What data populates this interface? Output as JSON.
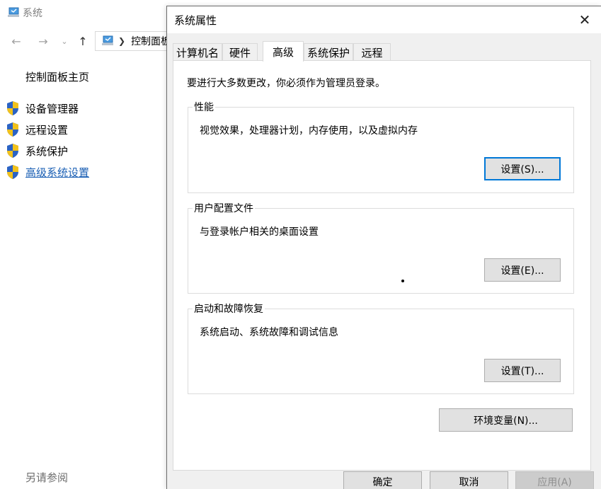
{
  "system_window": {
    "title": "系统",
    "address": "控制面板",
    "home_link": "控制面板主页",
    "links": [
      {
        "label": "设备管理器"
      },
      {
        "label": "远程设置"
      },
      {
        "label": "系统保护"
      },
      {
        "label": "高级系统设置"
      }
    ],
    "see_also": "另请参阅"
  },
  "dialog": {
    "title": "系统属性",
    "tabs": [
      {
        "label": "计算机名"
      },
      {
        "label": "硬件"
      },
      {
        "label": "高级"
      },
      {
        "label": "系统保护"
      },
      {
        "label": "远程"
      }
    ],
    "active_tab": "高级",
    "note": "要进行大多数更改，你必须作为管理员登录。",
    "groups": [
      {
        "title": "性能",
        "desc": "视觉效果，处理器计划，内存使用，以及虚拟内存",
        "button": "设置(S)..."
      },
      {
        "title": "用户配置文件",
        "desc": "与登录帐户相关的桌面设置",
        "button": "设置(E)..."
      },
      {
        "title": "启动和故障恢复",
        "desc": "系统启动、系统故障和调试信息",
        "button": "设置(T)..."
      }
    ],
    "env_button": "环境变量(N)...",
    "ok_button": "确定",
    "cancel_button": "取消",
    "apply_button": "应用(A)"
  },
  "colors": {
    "link_active": "#1a5fb4",
    "focus_border": "#0078d7",
    "dialog_bg": "#f0f0f0"
  },
  "icons": {
    "system": "computer-icon",
    "shield": "uac-shield-icon",
    "close": "close-icon",
    "back": "back-arrow-icon",
    "forward": "forward-arrow-icon",
    "up": "up-arrow-icon"
  }
}
